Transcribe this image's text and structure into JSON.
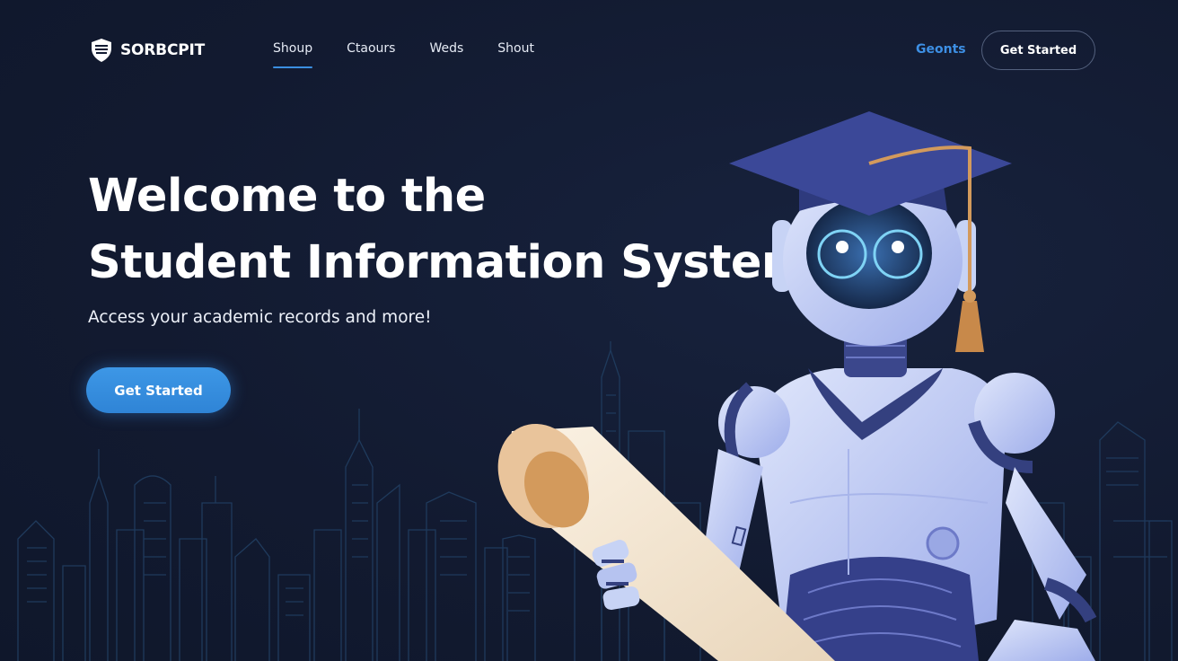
{
  "brand": {
    "name": "SORBCPIT",
    "icon": "shield-logo-icon"
  },
  "nav": {
    "items": [
      {
        "label": "Shoup",
        "active": true
      },
      {
        "label": "Ctaours",
        "active": false
      },
      {
        "label": "Weds",
        "active": false
      },
      {
        "label": "Shout",
        "active": false
      }
    ],
    "right_link": "Geonts",
    "cta_label": "Get Started"
  },
  "hero": {
    "title_line1": "Welcome to the",
    "title_line2": "Student Information System",
    "subtitle": "Access your academic records and more!",
    "cta_label": "Get Started"
  },
  "illustration": {
    "subject": "robot-graduate-illustration",
    "background": "city-skyline-illustration"
  },
  "colors": {
    "background": "#131c33",
    "accent": "#3b8fe0",
    "robot_body": "#c7d3f5",
    "robot_dark": "#34407f",
    "scroll": "#f6e8d2",
    "tassel": "#d39a5c"
  }
}
